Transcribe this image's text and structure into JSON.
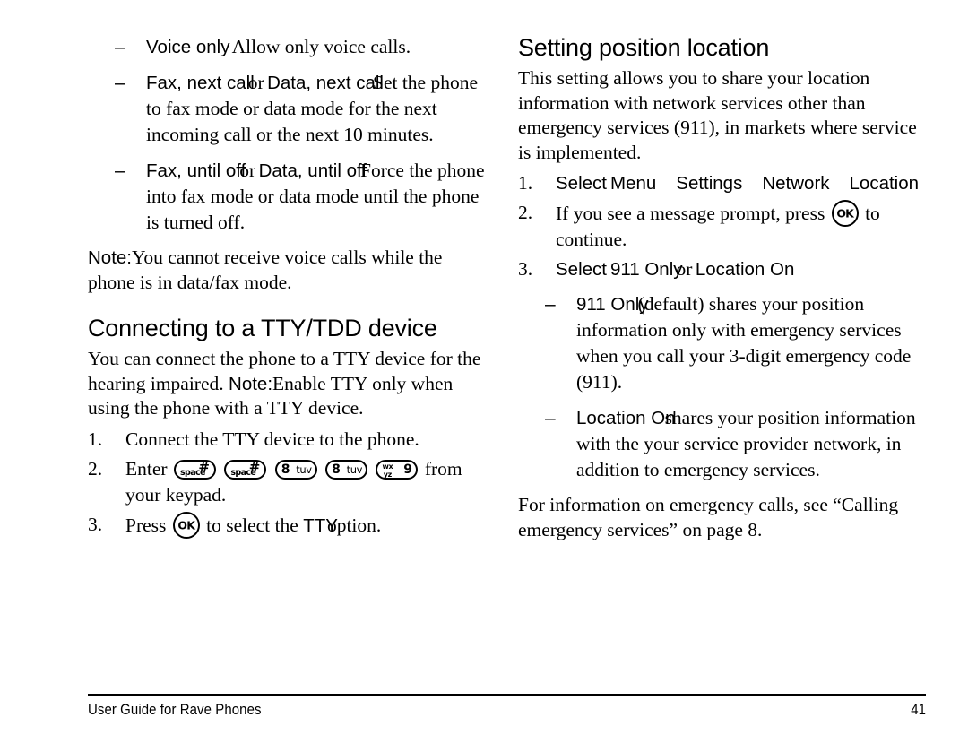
{
  "footer": {
    "left": "User Guide for Rave Phones",
    "page_number": "41"
  },
  "left_column": {
    "call_mode_bullets": [
      {
        "dash": "–",
        "term": "Voice only",
        "description": "Allow only voice calls."
      },
      {
        "dash": "–",
        "term1": "Fax, next call",
        "conjunction": "or",
        "term2": "Data, next call",
        "description": "Set the phone to fax mode or data mode for the next incoming call or the next 10 minutes."
      },
      {
        "dash": "–",
        "term1": "Fax, until off",
        "conjunction": "or",
        "term2": "Data, until off",
        "description": "Force the phone into fax mode or data mode until the phone is turned off."
      }
    ],
    "note": {
      "label": "Note:",
      "text": "You cannot receive voice calls while the phone is in data/fax mode."
    },
    "tty_heading": "Connecting to a TTY/TDD device",
    "tty_intro_before": "You can connect the phone to a TTY device for the hearing impaired.",
    "tty_note_label": "Note:",
    "tty_note_text": "Enable TTY only when using the phone with a TTY device.",
    "tty_steps": [
      {
        "number": "1.",
        "text": "Connect the TTY device to the phone."
      },
      {
        "number": "2.",
        "text_before": "Enter",
        "keys": [
          {
            "type": "pill",
            "space_label": "space",
            "hash_label": "#",
            "name": "key-space-hash"
          },
          {
            "type": "pill",
            "space_label": "space",
            "hash_label": "#",
            "name": "key-space-hash"
          },
          {
            "type": "pill",
            "digit": "8",
            "letters": "tuv",
            "name": "key-8-tuv"
          },
          {
            "type": "pill",
            "digit": "8",
            "letters": "tuv",
            "name": "key-8-tuv"
          },
          {
            "type": "pill",
            "digit": "9",
            "letters_top": "wx",
            "letters_bottom": "yz",
            "name": "key-9-wxyz"
          }
        ],
        "text_after": "from your keypad."
      },
      {
        "number": "3.",
        "text_before": "Press",
        "ok_key": "OK",
        "text_mid": "to select the",
        "term": "TTY",
        "text_after": "option."
      }
    ]
  },
  "right_column": {
    "heading": "Setting position location",
    "intro": "This setting allows you to share your location information with network services other than emergency services (911), in markets where service is implemented.",
    "steps": [
      {
        "number": "1.",
        "text_before": "Select",
        "menu_path": [
          "Menu",
          "Settings",
          "Network",
          "Location"
        ]
      },
      {
        "number": "2.",
        "text_before": "If you see a message prompt, press",
        "ok_key": "OK",
        "text_after": "to continue."
      },
      {
        "number": "3.",
        "text_before": "Select",
        "option1": "911 Only",
        "conjunction": "or",
        "option2": "Location On"
      }
    ],
    "option_bullets": [
      {
        "dash": "–",
        "term": "911 Only",
        "description": "(default) shares your position information only with emergency services when you call your 3-digit emergency code (911)."
      },
      {
        "dash": "–",
        "term": "Location On",
        "description": "shares your position information with the your service provider network, in addition to emergency services."
      }
    ],
    "closing": "For information on emergency calls, see “Calling emergency services” on page 8."
  }
}
